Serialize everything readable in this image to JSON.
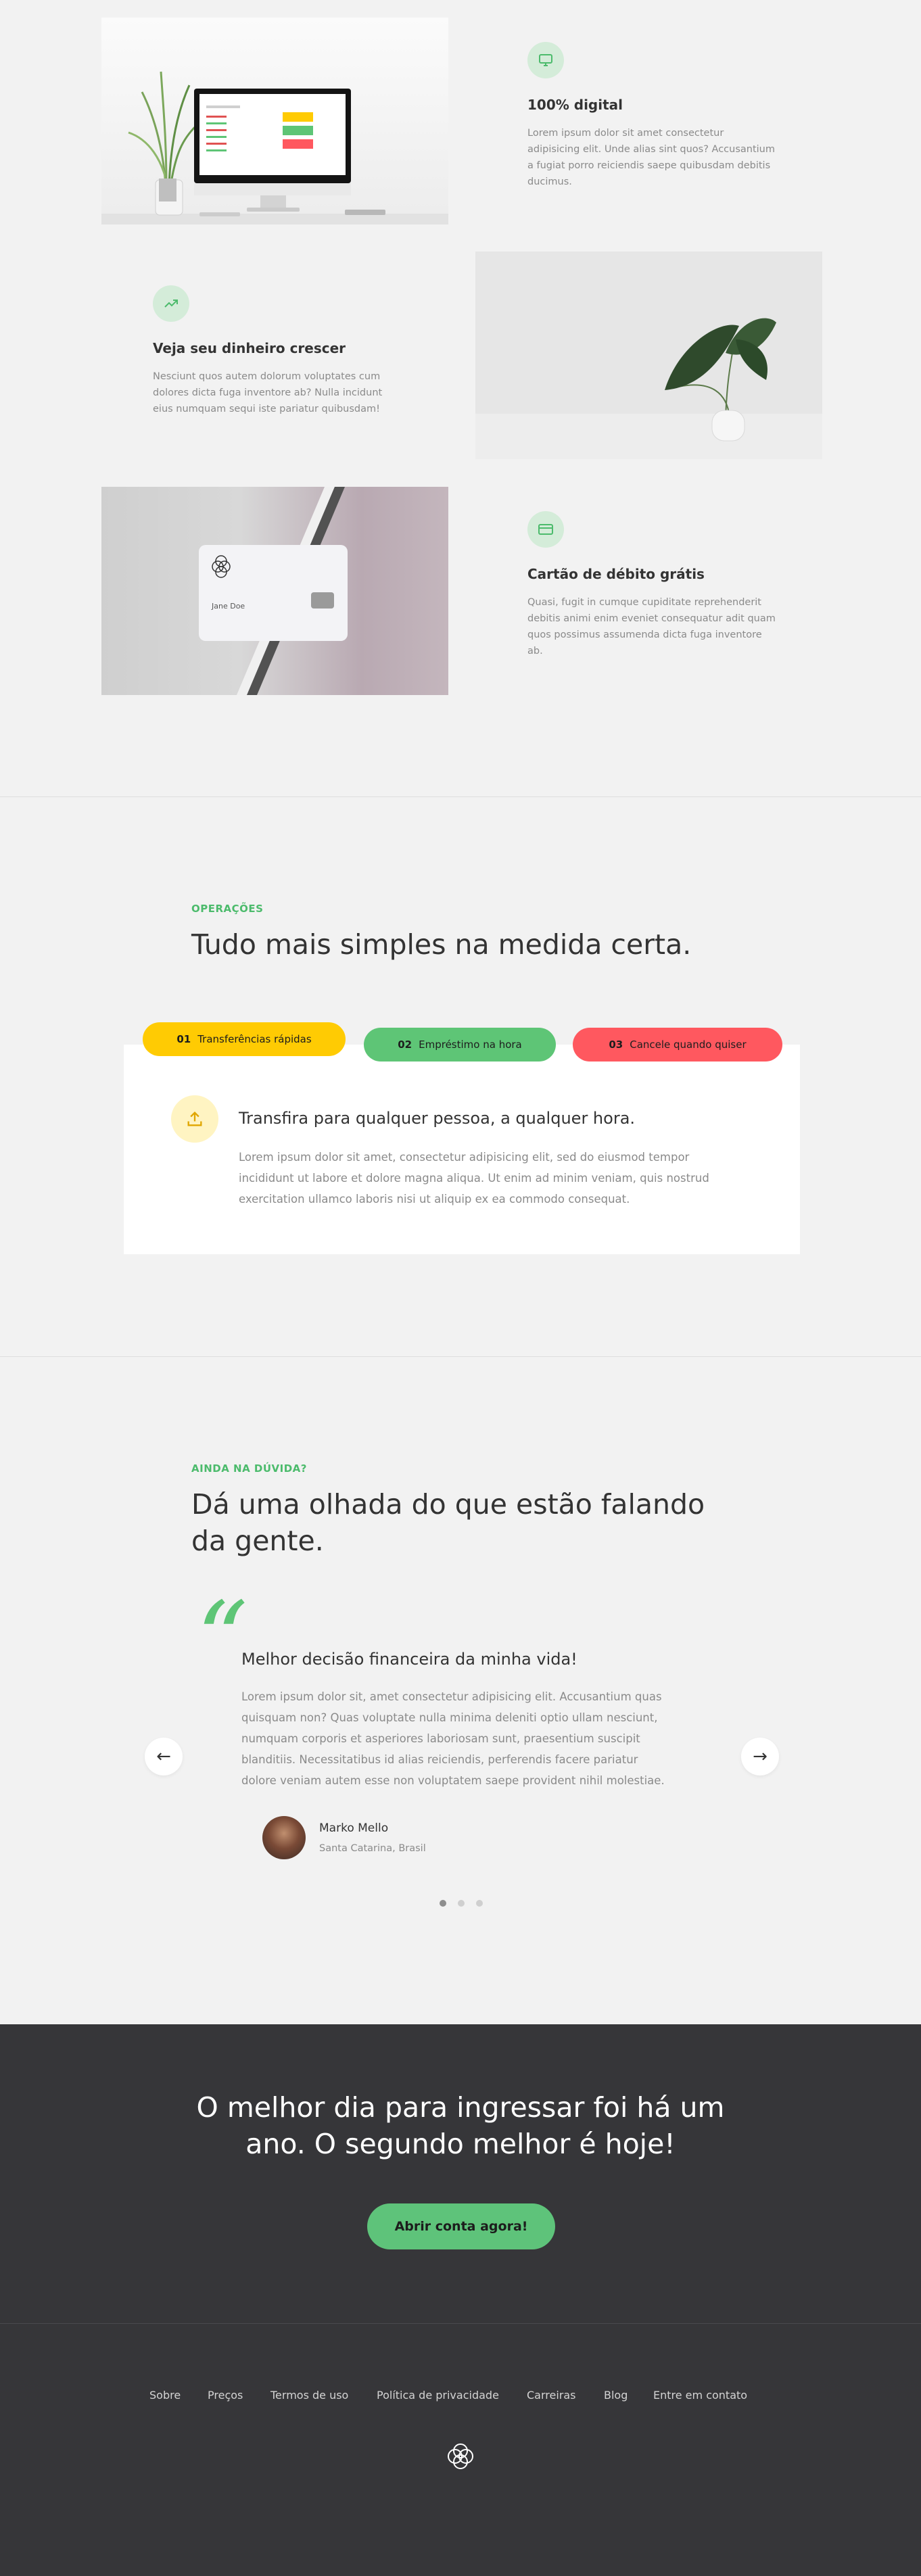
{
  "features": [
    {
      "title": "100% digital",
      "text": "Lorem ipsum dolor sit amet consectetur adipisicing elit. Unde alias sint quos? Accusantium a fugiat porro reiciendis saepe quibusdam debitis ducimus.",
      "icon": "monitor-icon"
    },
    {
      "title": "Veja seu dinheiro crescer",
      "text": "Nesciunt quos autem dolorum voluptates cum dolores dicta fuga inventore ab? Nulla incidunt eius numquam sequi iste pariatur quibusdam!",
      "icon": "trending-up-icon"
    },
    {
      "title": "Cartão de débito grátis",
      "text": "Quasi, fugit in cumque cupiditate reprehenderit debitis animi enim eveniet consequatur adit quam quos possimus assumenda dicta fuga inventore ab.",
      "icon": "credit-card-icon"
    }
  ],
  "card_name": "Jane Doe",
  "operations": {
    "eyebrow": "OPERAÇÕES",
    "title": "Tudo mais simples na medida certa.",
    "tabs": [
      {
        "num": "01",
        "label": "Transferências rápidas",
        "color": "#ffcb03"
      },
      {
        "num": "02",
        "label": "Empréstimo na hora",
        "color": "#5ec576"
      },
      {
        "num": "03",
        "label": "Cancele quando quiser",
        "color": "#ff585f"
      }
    ],
    "active": {
      "title": "Transfira para qualquer pessoa, a qualquer hora.",
      "text": "Lorem ipsum dolor sit amet, consectetur adipisicing elit, sed do eiusmod tempor incididunt ut labore et dolore magna aliqua. Ut enim ad minim veniam, quis nostrud exercitation ullamco laboris nisi ut aliquip ex ea commodo consequat."
    }
  },
  "testimonials": {
    "eyebrow": "AINDA NA DÚVIDA?",
    "title_line1": "Dá uma olhada do que estão falando",
    "title_line2": "da gente.",
    "quote_mark": "“",
    "headline": "Melhor decisão financeira da minha vida!",
    "text": "Lorem ipsum dolor sit, amet consectetur adipisicing elit. Accusantium quas quisquam non? Quas voluptate nulla minima deleniti optio ullam nesciunt, numquam corporis et asperiores laboriosam sunt, praesentium suscipit blanditiis. Necessitatibus id alias reiciendis, perferendis facere pariatur dolore veniam autem esse non voluptatem saepe provident nihil molestiae.",
    "author": "Marko Mello",
    "location": "Santa Catarina, Brasil",
    "prev": "←",
    "next": "→"
  },
  "cta": {
    "title_line1": "O melhor dia para ingressar foi há um",
    "title_line2": "ano. O segundo melhor é hoje!",
    "button": "Abrir conta agora!"
  },
  "footer": {
    "links": [
      "Sobre",
      "Preços",
      "Termos de uso",
      "Política de privacidade",
      "Carreiras",
      "Blog",
      "Entre em contato"
    ]
  },
  "colors": {
    "accent": "#5ec576",
    "yellow": "#ffcb03",
    "red": "#ff585f",
    "dark": "#37383d"
  }
}
